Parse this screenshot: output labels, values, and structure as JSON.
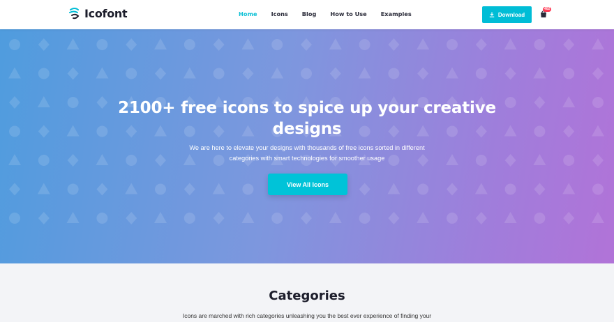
{
  "nav": {
    "logo_text": "Icofont",
    "links": [
      {
        "label": "Home",
        "active": true
      },
      {
        "label": "Icons",
        "active": false
      },
      {
        "label": "Blog",
        "active": false
      },
      {
        "label": "How to Use",
        "active": false
      },
      {
        "label": "Examples",
        "active": false
      }
    ],
    "download_label": "Download",
    "download_icon": "download-icon",
    "cart_icon": "shopping-bag-icon",
    "cart_count": "402"
  },
  "hero": {
    "title": "2100+ free icons to spice up your creative designs",
    "description": "We are here to elevate your designs with thousands of free icons sorted in different categories with smart technologies for smoother usage",
    "cta_label": "View All Icons"
  },
  "categories": {
    "title": "Categories",
    "description": "Icons are marched with rich categories unleashing you the best ever experience of finding your"
  },
  "colors": {
    "accent": "#00bdd6",
    "nav_active": "#0fc1d6",
    "hero_start": "#4f9cde",
    "hero_end": "#b173d8",
    "badge": "#ff3d57"
  }
}
